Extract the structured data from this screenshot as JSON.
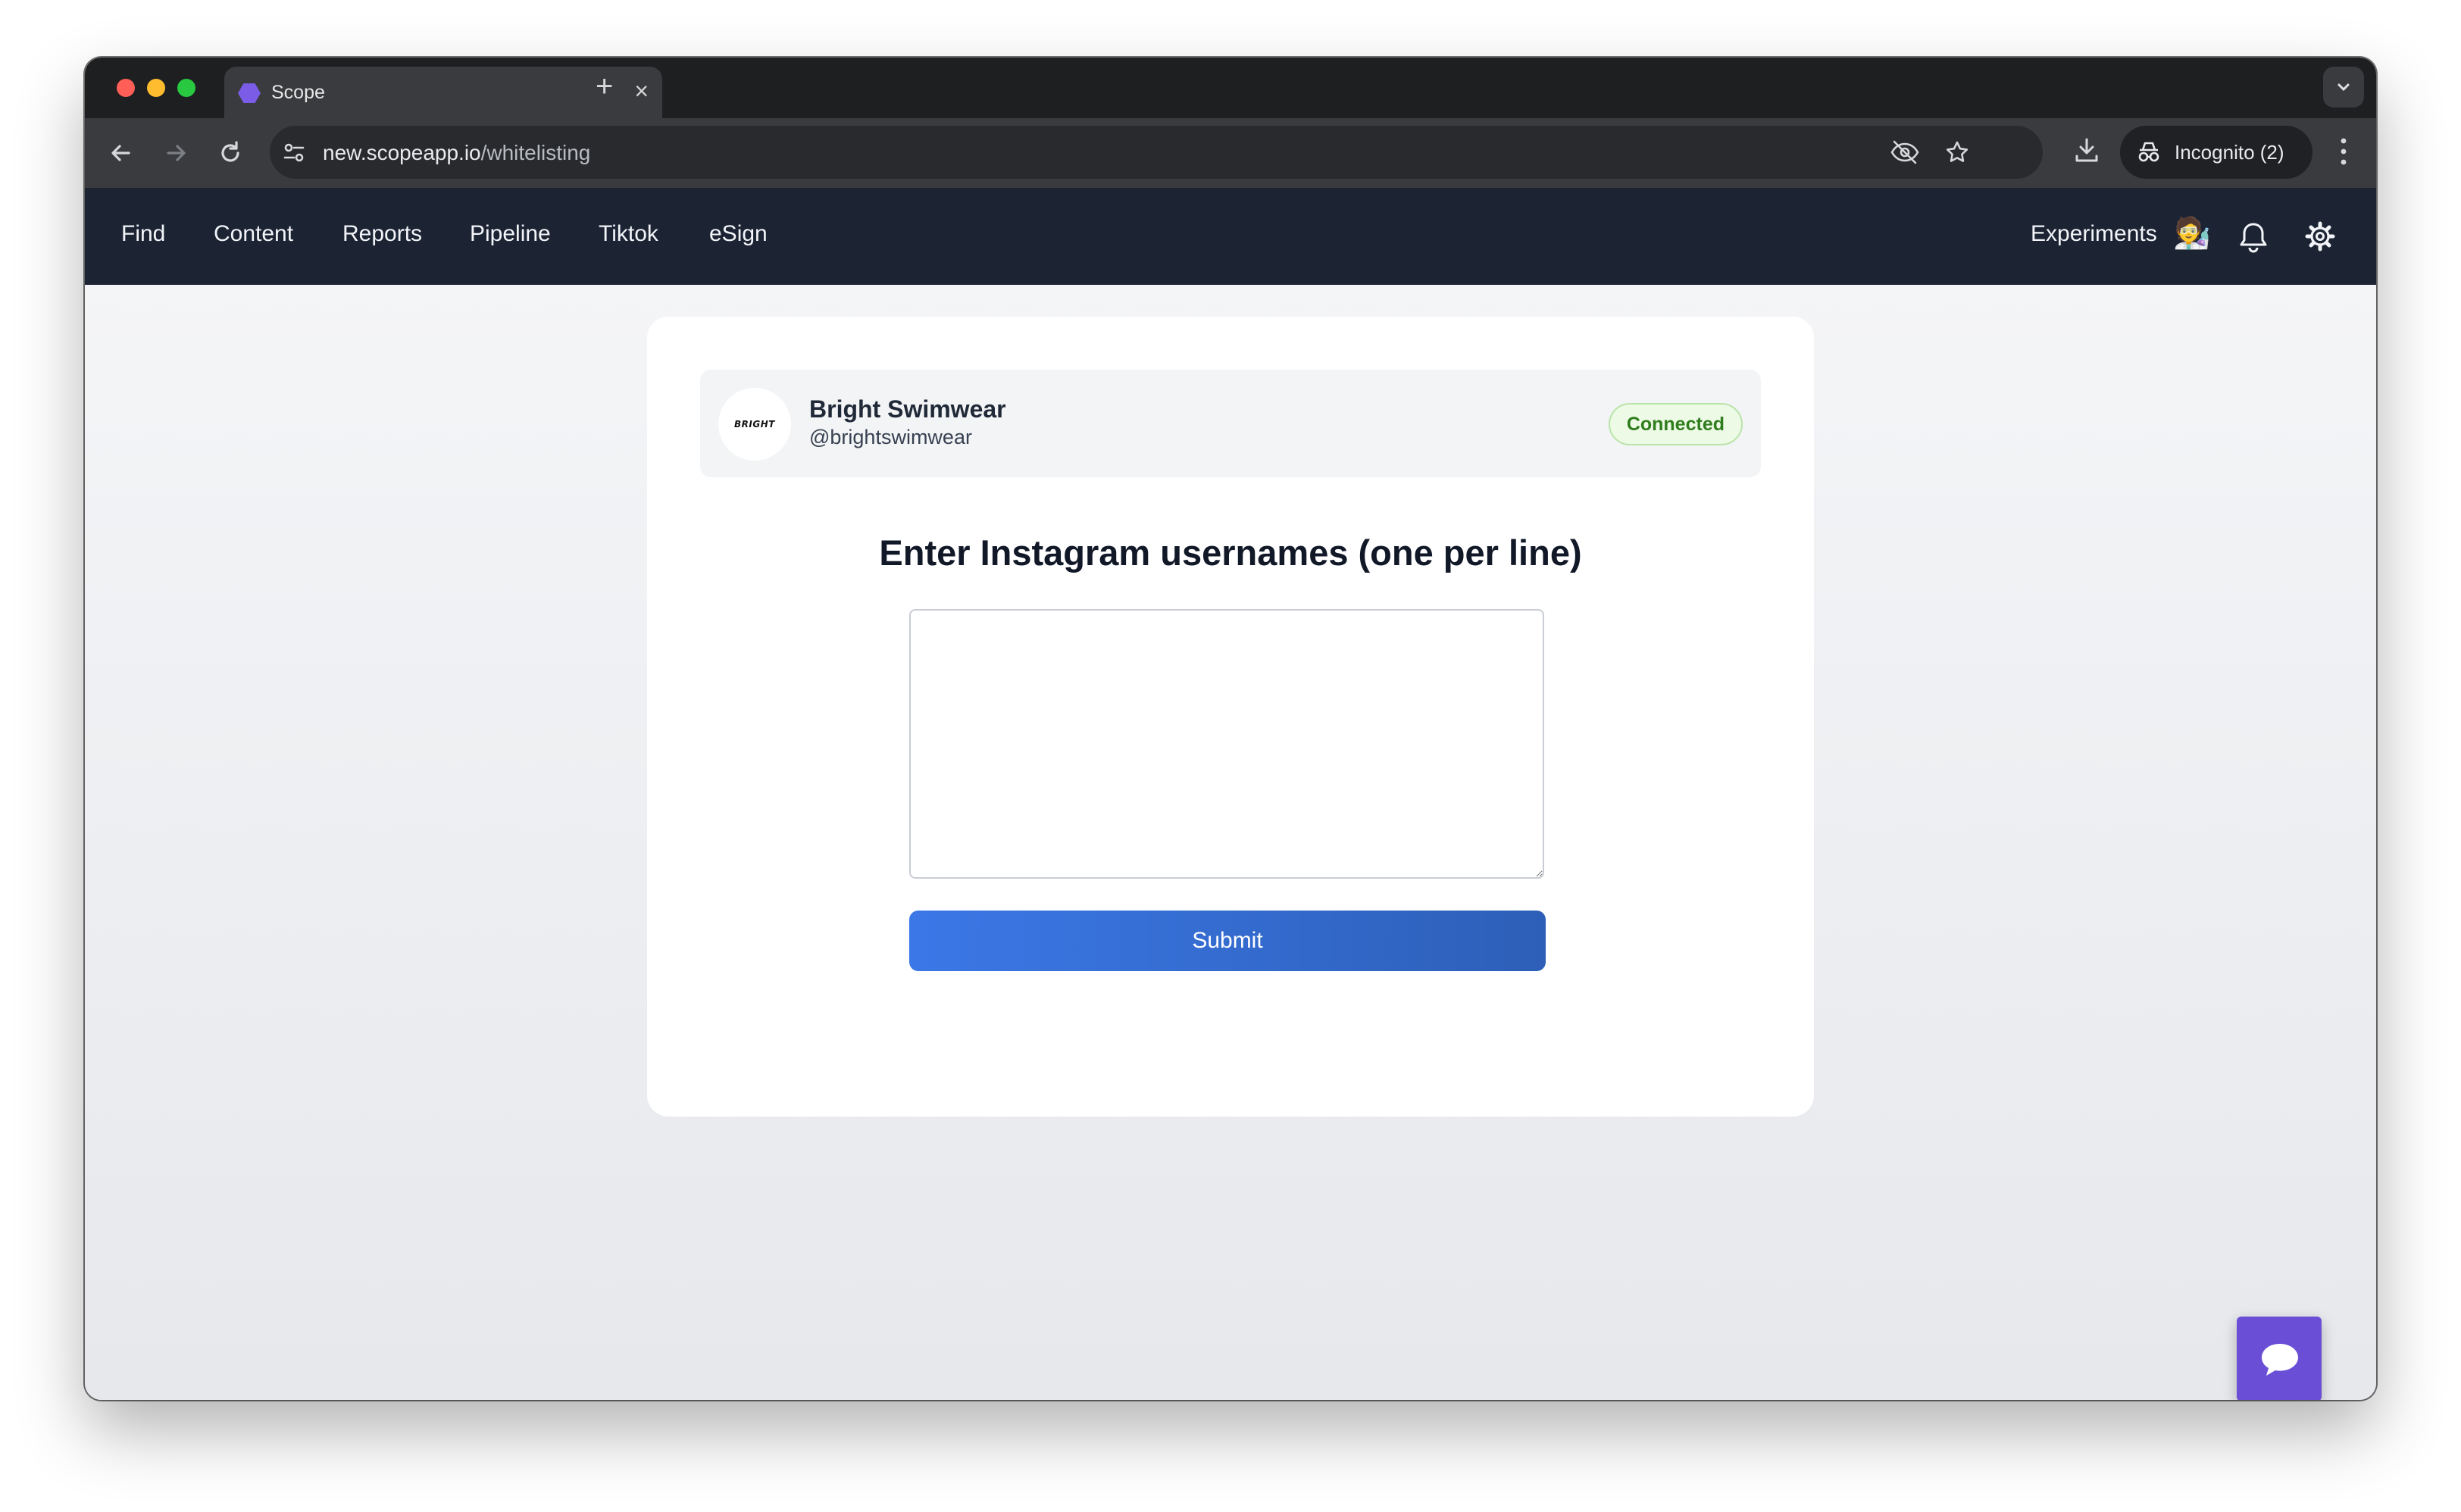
{
  "browser": {
    "tab_title": "Scope",
    "url_host": "new.scopeapp.io",
    "url_path": "/whitelisting",
    "incognito_label": "Incognito (2)"
  },
  "nav": {
    "links": [
      "Find",
      "Content",
      "Reports",
      "Pipeline",
      "Tiktok",
      "eSign"
    ],
    "experiments_label": "Experiments",
    "experiments_emoji": "🧑‍🔬"
  },
  "account": {
    "logo_text": "BRIGHT",
    "name": "Bright Swimwear",
    "handle": "@brightswimwear",
    "status": "Connected"
  },
  "form": {
    "heading": "Enter Instagram usernames (one per line)",
    "textarea_value": "",
    "submit_label": "Submit"
  },
  "icons": {
    "tab_favicon": "scope-hexagon-icon",
    "chat": "chat-bubble-icon",
    "bell": "bell-icon",
    "settings": "gear-icon"
  },
  "colors": {
    "nav_bg": "#1c2434",
    "connected_green": "#2f7d1d",
    "submit_blue": "#3b78e7",
    "chat_purple": "#6a4fd6"
  }
}
